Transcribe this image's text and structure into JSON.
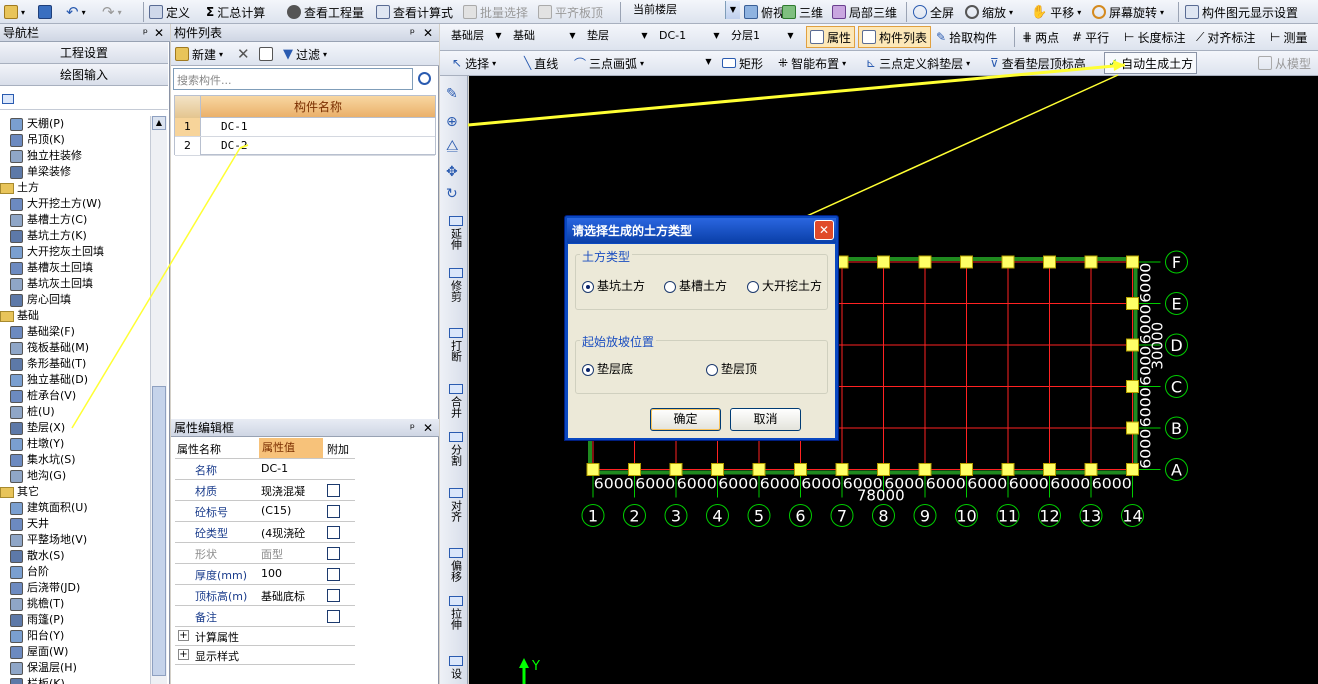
{
  "toolbar1": {
    "define": "定义",
    "sum_calc": "汇总计算",
    "view_quantity": "查看工程量",
    "view_formula": "查看计算式",
    "batch_select": "批量选择",
    "flush_slab": "平齐板顶",
    "floor_combo": "当前楼层",
    "top_view": "俯视",
    "three_d": "三维",
    "partial_3d": "局部三维",
    "fullscreen": "全屏",
    "zoom": "缩放",
    "pan": "平移",
    "rotate": "屏幕旋转",
    "display_settings": "构件图元显示设置"
  },
  "toolbar2": {
    "layer_group": "基础层",
    "category": "基础",
    "element_type": "垫层",
    "element": "DC-1",
    "sublayer": "分层1",
    "properties": "属性",
    "component_list": "构件列表",
    "pick_component": "拾取构件",
    "two_points": "两点",
    "parallel": "平行",
    "length_dim": "长度标注",
    "align_dim": "对齐标注",
    "measure": "测量"
  },
  "toolbar3": {
    "select": "选择",
    "line": "直线",
    "arc": "三点画弧",
    "rect": "矩形",
    "smart_layout": "智能布置",
    "slope_cushion": "三点定义斜垫层",
    "view_elevation": "查看垫层顶标高",
    "auto_earthwork": "自动生成土方",
    "from_model": "从模型"
  },
  "nav": {
    "title": "导航栏",
    "project_settings": "工程设置",
    "drawing_input": "绘图输入",
    "items": [
      {
        "label": "天棚(P)",
        "type": "item"
      },
      {
        "label": "吊顶(K)",
        "type": "item"
      },
      {
        "label": "独立柱装修",
        "type": "item"
      },
      {
        "label": "单梁装修",
        "type": "item"
      },
      {
        "label": "土方",
        "type": "folder"
      },
      {
        "label": "大开挖土方(W)",
        "type": "item"
      },
      {
        "label": "基槽土方(C)",
        "type": "item"
      },
      {
        "label": "基坑土方(K)",
        "type": "item"
      },
      {
        "label": "大开挖灰土回填",
        "type": "item"
      },
      {
        "label": "基槽灰土回填",
        "type": "item"
      },
      {
        "label": "基坑灰土回填",
        "type": "item"
      },
      {
        "label": "房心回填",
        "type": "item"
      },
      {
        "label": "基础",
        "type": "folder"
      },
      {
        "label": "基础梁(F)",
        "type": "item"
      },
      {
        "label": "筏板基础(M)",
        "type": "item"
      },
      {
        "label": "条形基础(T)",
        "type": "item"
      },
      {
        "label": "独立基础(D)",
        "type": "item"
      },
      {
        "label": "桩承台(V)",
        "type": "item"
      },
      {
        "label": "桩(U)",
        "type": "item"
      },
      {
        "label": "垫层(X)",
        "type": "item"
      },
      {
        "label": "柱墩(Y)",
        "type": "item"
      },
      {
        "label": "集水坑(S)",
        "type": "item"
      },
      {
        "label": "地沟(G)",
        "type": "item"
      },
      {
        "label": "其它",
        "type": "folder"
      },
      {
        "label": "建筑面积(U)",
        "type": "item"
      },
      {
        "label": "天井",
        "type": "item"
      },
      {
        "label": "平整场地(V)",
        "type": "item"
      },
      {
        "label": "散水(S)",
        "type": "item"
      },
      {
        "label": "台阶",
        "type": "item"
      },
      {
        "label": "后浇带(JD)",
        "type": "item"
      },
      {
        "label": "挑檐(T)",
        "type": "item"
      },
      {
        "label": "雨篷(P)",
        "type": "item"
      },
      {
        "label": "阳台(Y)",
        "type": "item"
      },
      {
        "label": "屋面(W)",
        "type": "item"
      },
      {
        "label": "保温层(H)",
        "type": "item"
      },
      {
        "label": "栏板(K)",
        "type": "item"
      }
    ]
  },
  "component_list": {
    "title": "构件列表",
    "new": "新建",
    "filter": "过滤",
    "search_placeholder": "搜索构件...",
    "header": "构件名称",
    "rows": [
      {
        "num": "1",
        "name": "DC-1"
      },
      {
        "num": "2",
        "name": "DC-2"
      }
    ]
  },
  "properties": {
    "title": "属性编辑框",
    "headers": [
      "属性名称",
      "属性值",
      "附加"
    ],
    "rows": [
      {
        "name": "名称",
        "value": "DC-1"
      },
      {
        "name": "材质",
        "value": "现浇混凝"
      },
      {
        "name": "砼标号",
        "value": "(C15)"
      },
      {
        "name": "砼类型",
        "value": "(4现浇砼"
      },
      {
        "name": "形状",
        "value": "面型"
      },
      {
        "name": "厚度(mm)",
        "value": "100"
      },
      {
        "name": "顶标高(m)",
        "value": "基础底标"
      },
      {
        "name": "备注",
        "value": ""
      }
    ],
    "calc_attrs": "计算属性",
    "display_style": "显示样式"
  },
  "left_tools": [
    "延伸",
    "修剪",
    "打断",
    "合并",
    "分割",
    "对齐",
    "偏移",
    "拉伸",
    "设"
  ],
  "dialog": {
    "title": "请选择生成的土方类型",
    "group1": "土方类型",
    "options1": [
      "基坑土方",
      "基槽土方",
      "大开挖土方"
    ],
    "selected1": "基坑土方",
    "group2": "起始放坡位置",
    "options2": [
      "垫层底",
      "垫层顶"
    ],
    "selected2": "垫层底",
    "ok": "确定",
    "cancel": "取消"
  },
  "drawing": {
    "row_axes": [
      "F",
      "E",
      "D",
      "C",
      "B",
      "A"
    ],
    "col_axes": [
      "1",
      "2",
      "3",
      "4",
      "5",
      "6",
      "7",
      "8",
      "9",
      "10",
      "11",
      "12",
      "13",
      "14"
    ],
    "bay_width": "6000",
    "total_width": "78000",
    "total_height": "30000",
    "y_axis_label": "Y",
    "colors": {
      "grid": "#ff2222",
      "axis": "#00cc00",
      "column": "#ffff66",
      "canvas": "#000000",
      "beam": "#1f8a1f"
    }
  }
}
